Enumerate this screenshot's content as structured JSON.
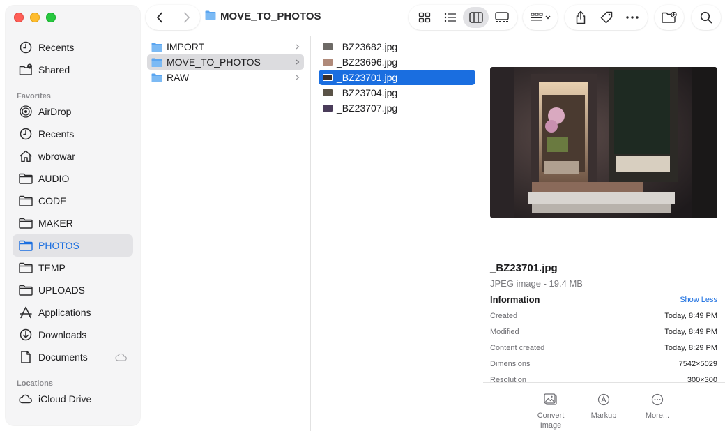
{
  "window": {
    "title": "MOVE_TO_PHOTOS"
  },
  "sidebar": {
    "top_items": [
      {
        "label": "Recents",
        "icon": "clock-icon"
      },
      {
        "label": "Shared",
        "icon": "shared-folder-icon"
      }
    ],
    "favorites_header": "Favorites",
    "favorites": [
      {
        "label": "AirDrop",
        "icon": "airdrop-icon"
      },
      {
        "label": "Recents",
        "icon": "clock-icon"
      },
      {
        "label": "wbrowar",
        "icon": "home-icon"
      },
      {
        "label": "AUDIO",
        "icon": "folder-icon"
      },
      {
        "label": "CODE",
        "icon": "folder-icon"
      },
      {
        "label": "MAKER",
        "icon": "folder-icon"
      },
      {
        "label": "PHOTOS",
        "icon": "folder-icon",
        "selected": true
      },
      {
        "label": "TEMP",
        "icon": "folder-icon"
      },
      {
        "label": "UPLOADS",
        "icon": "folder-icon"
      },
      {
        "label": "Applications",
        "icon": "applications-icon"
      },
      {
        "label": "Downloads",
        "icon": "download-icon"
      },
      {
        "label": "Documents",
        "icon": "document-icon",
        "cloud": true
      }
    ],
    "locations_header": "Locations",
    "locations": [
      {
        "label": "iCloud Drive",
        "icon": "cloud-icon"
      }
    ]
  },
  "columns": {
    "folders": [
      {
        "label": "IMPORT"
      },
      {
        "label": "MOVE_TO_PHOTOS",
        "highlighted": true
      },
      {
        "label": "RAW"
      }
    ],
    "files": [
      {
        "label": "_BZ23682.jpg",
        "thumb_color": "#6d6a66"
      },
      {
        "label": "_BZ23696.jpg",
        "thumb_color": "#b08a7a"
      },
      {
        "label": "_BZ23701.jpg",
        "thumb_color": "#3a2f2a",
        "selected": true
      },
      {
        "label": "_BZ23704.jpg",
        "thumb_color": "#5a5347"
      },
      {
        "label": "_BZ23707.jpg",
        "thumb_color": "#4a3c5a"
      }
    ]
  },
  "preview": {
    "file_name": "_BZ23701.jpg",
    "file_kind": "JPEG image - 19.4 MB",
    "info_header": "Information",
    "show_less": "Show Less",
    "info": [
      {
        "key": "Created",
        "value": "Today, 8:49 PM"
      },
      {
        "key": "Modified",
        "value": "Today, 8:49 PM"
      },
      {
        "key": "Content created",
        "value": "Today, 8:29 PM"
      },
      {
        "key": "Dimensions",
        "value": "7542×5029"
      },
      {
        "key": "Resolution",
        "value": "300×300"
      }
    ],
    "actions": [
      {
        "label": "Convert Image"
      },
      {
        "label": "Markup"
      },
      {
        "label": "More..."
      }
    ]
  },
  "colors": {
    "accent": "#1a6ee0",
    "folder": "#5aa5f0"
  }
}
